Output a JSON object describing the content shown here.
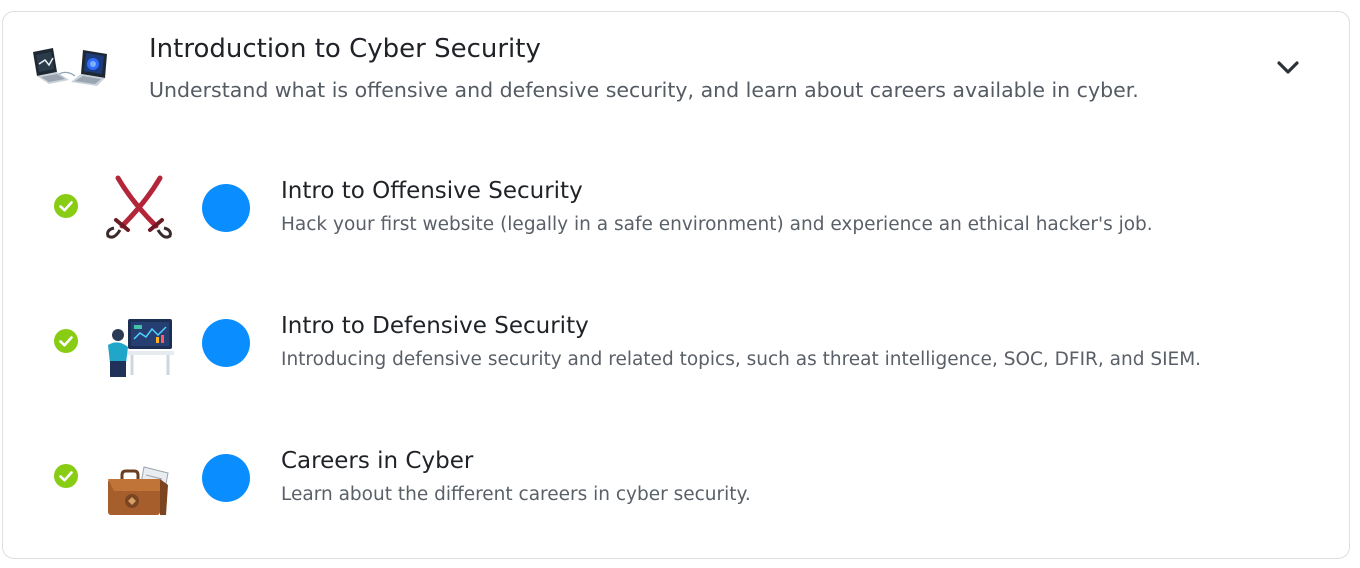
{
  "module": {
    "title": "Introduction to Cyber Security",
    "subtitle": "Understand what is offensive and defensive security, and learn about careers available in cyber.",
    "icon": "laptops-icon",
    "expand_icon": "chevron-down-icon"
  },
  "colors": {
    "check": "#88cc14",
    "dot": "#0a8eff",
    "title": "#1f2328",
    "text": "#5a6068",
    "border": "#dcdfe3"
  },
  "rooms": [
    {
      "title": "Intro to Offensive Security",
      "description": "Hack your first website (legally in a safe environment) and experience an ethical hacker's job.",
      "completed": true,
      "icon": "crossed-swords-icon"
    },
    {
      "title": "Intro to Defensive Security",
      "description": "Introducing defensive security and related topics, such as threat intelligence, SOC, DFIR, and SIEM.",
      "completed": true,
      "icon": "analyst-workstation-icon"
    },
    {
      "title": "Careers in Cyber",
      "description": "Learn about the different careers in cyber security.",
      "completed": true,
      "icon": "briefcase-icon"
    }
  ]
}
